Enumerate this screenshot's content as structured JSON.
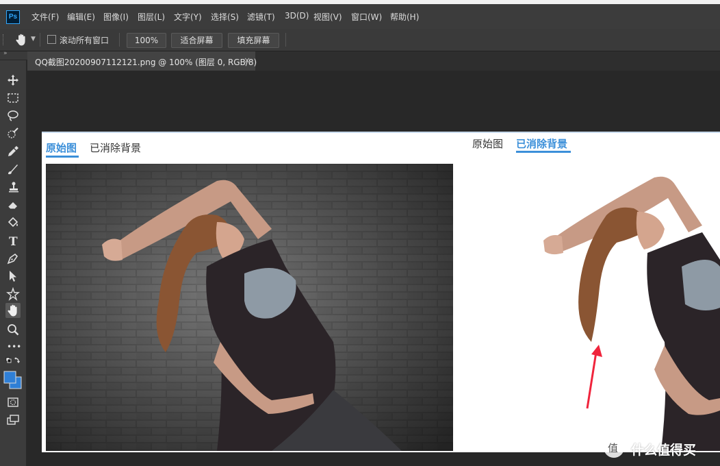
{
  "app": {
    "logo": "Ps"
  },
  "menu": [
    {
      "label": "文件(F)"
    },
    {
      "label": "编辑(E)"
    },
    {
      "label": "图像(I)"
    },
    {
      "label": "图层(L)"
    },
    {
      "label": "文字(Y)"
    },
    {
      "label": "选择(S)"
    },
    {
      "label": "滤镜(T)"
    },
    {
      "label": "3D(D)"
    },
    {
      "label": "视图(V)"
    },
    {
      "label": "窗口(W)"
    },
    {
      "label": "帮助(H)"
    }
  ],
  "options": {
    "scroll_all_label": "滚动所有窗口",
    "zoom_value": "100%",
    "fit_screen_label": "适合屏幕",
    "fill_screen_label": "填充屏幕"
  },
  "document": {
    "tab_title": "QQ截图20200907112121.png @ 100% (图层 0, RGB/8)",
    "close_glyph": "×"
  },
  "canvas": {
    "left_tabs": {
      "original": "原始图",
      "removed": "已消除背景",
      "active": "original"
    },
    "right_tabs": {
      "original": "原始图",
      "removed": "已消除背景",
      "active": "removed"
    }
  },
  "watermark": {
    "text": "什么值得买",
    "glyph": "值"
  },
  "colors": {
    "accent_blue": "#3b8fd9",
    "ps_blue": "#31a8ff",
    "foreground_swatch": "#2f7fd6",
    "arrow_red": "#f0243c"
  },
  "tools": [
    {
      "icon": "move-icon"
    },
    {
      "icon": "marquee-icon"
    },
    {
      "icon": "lasso-icon"
    },
    {
      "icon": "quick-select-icon"
    },
    {
      "icon": "eyedropper-icon"
    },
    {
      "icon": "brush-icon"
    },
    {
      "icon": "stamp-icon"
    },
    {
      "icon": "eraser-icon"
    },
    {
      "icon": "paint-bucket-icon"
    },
    {
      "icon": "type-icon"
    },
    {
      "icon": "pen-icon"
    },
    {
      "icon": "path-select-icon"
    },
    {
      "icon": "shape-icon"
    },
    {
      "icon": "hand-icon"
    },
    {
      "icon": "zoom-icon"
    },
    {
      "icon": "more-tools-icon"
    },
    {
      "icon": "color-swatch-icon"
    },
    {
      "icon": "quick-mask-icon"
    },
    {
      "icon": "screen-mode-icon"
    }
  ],
  "type_tool_glyph": "T",
  "more_tools_glyph": "•••"
}
